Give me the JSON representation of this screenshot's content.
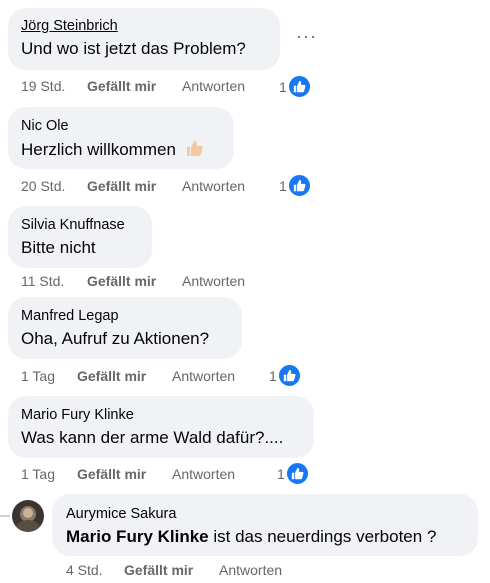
{
  "comments": [
    {
      "author": "Jörg Steinbrich",
      "text": "Und wo ist jetzt das Problem?",
      "time": "19 Std.",
      "like": "Gefällt mir",
      "reply": "Antworten",
      "reactions": "1",
      "more_icon": "more-dots-icon"
    },
    {
      "author": "Nic Ole",
      "text": "Herzlich willkommen",
      "emoji": "👍🏻",
      "time": "20 Std.",
      "like": "Gefällt mir",
      "reply": "Antworten",
      "reactions": "1"
    },
    {
      "author": "Silvia Knuffnase",
      "text": "Bitte nicht",
      "time": "11 Std.",
      "like": "Gefällt mir",
      "reply": "Antworten"
    },
    {
      "author": "Manfred Legap",
      "text": "Oha, Aufruf zu Aktionen?",
      "time": "1 Tag",
      "like": "Gefällt mir",
      "reply": "Antworten",
      "reactions": "1"
    },
    {
      "author": "Mario Fury Klinke",
      "text": "Was kann der arme Wald dafür?....",
      "time": "1 Tag",
      "like": "Gefällt mir",
      "reply": "Antworten",
      "reactions": "1"
    }
  ],
  "reply": {
    "author": "Aurymice Sakura",
    "mention": "Mario Fury Klinke",
    "text": " ist das neuerdings verboten ?",
    "time": "4 Std.",
    "like": "Gefällt mir",
    "reply": "Antworten"
  },
  "colors": {
    "like_blue": "#1877f2",
    "bubble_bg": "#f0f2f5",
    "meta_grey": "#65676b"
  }
}
